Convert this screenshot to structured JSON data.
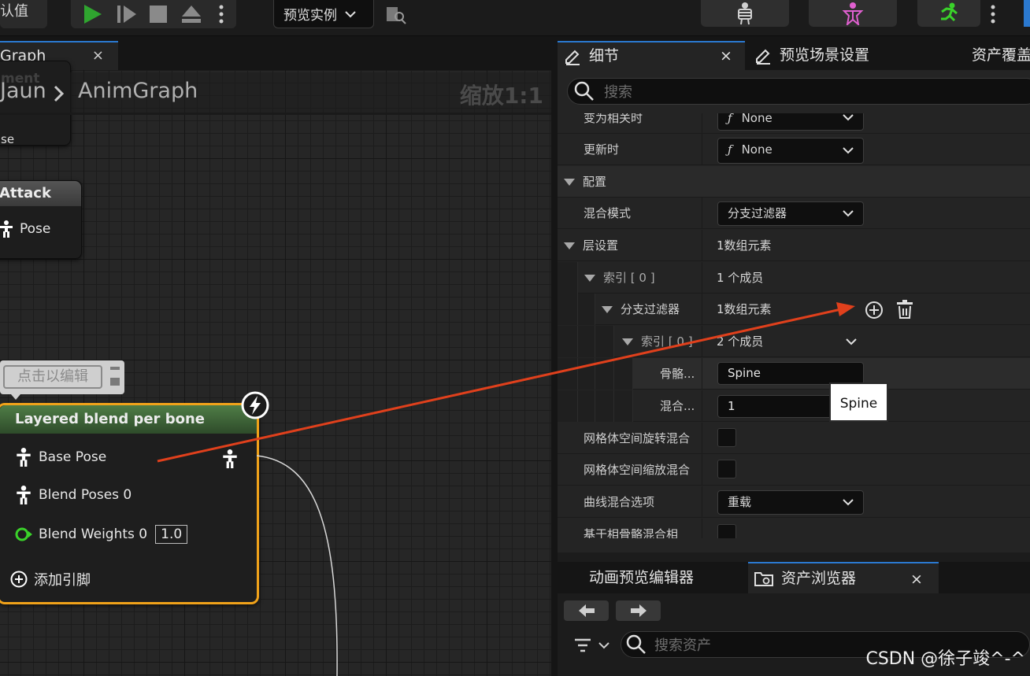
{
  "toolbar": {
    "class_defaults_label": "认值",
    "preview_instance_label": "预览实例"
  },
  "graph": {
    "tab_label": "Graph",
    "tab_close": "×",
    "breadcrumb_parent": "Jaun",
    "breadcrumb_current": "AnimGraph",
    "zoom_label": "缩放1:1",
    "comment_edit_label": "点击以编辑",
    "partial_node": {
      "line1": "ment",
      "line2": "se"
    },
    "attack_node": {
      "title": "Attack",
      "pin_label": "Pose"
    },
    "layered_node": {
      "title": "Layered blend per bone",
      "pins": {
        "base_pose": "Base Pose",
        "blend_poses": "Blend Poses 0",
        "blend_weights": "Blend Weights 0",
        "blend_weight_value": "1.0",
        "add_pin": "添加引脚"
      }
    }
  },
  "details": {
    "tab_details": "细节",
    "tab_close": "×",
    "tab_preview_scene": "预览场景设置",
    "tab_asset_override": "资产覆盖",
    "search_placeholder": "搜索",
    "rows": {
      "become_relevant_label": "变为相关时",
      "become_relevant_value": "None",
      "on_update_label": "更新时",
      "on_update_value": "None",
      "config_label": "配置",
      "blend_mode_label": "混合模式",
      "blend_mode_value": "分支过滤器",
      "layer_setup_label": "层设置",
      "layer_setup_value": "1数组元素",
      "index0_label": "索引 [ 0 ]",
      "index0_value": "1 个成员",
      "branch_filters_label": "分支过滤器",
      "branch_filters_value": "1数组元素",
      "index0b_label": "索引 [ 0 ]",
      "index0b_value": "2 个成员",
      "bone_label": "骨骼...",
      "bone_value": "Spine",
      "blend_depth_label": "混合...",
      "blend_depth_value": "1",
      "mesh_rot_label": "网格体空间旋转混合",
      "mesh_scale_label": "网格体空间缩放混合",
      "curve_blend_label": "曲线混合选项",
      "curve_blend_value": "重载",
      "ref_pose_label": "基于相骨骼混合相"
    },
    "tooltip": "Spine"
  },
  "bottom": {
    "tab_anim_preview": "动画预览编辑器",
    "tab_asset_browser": "资产浏览器",
    "tab_close": "×",
    "search_placeholder": "搜索资产"
  },
  "watermark": "CSDN @徐子竣^-^",
  "colors": {
    "accent_blue": "#2b79d0",
    "node_selected_border": "#f0a21a",
    "node_title_green": "#3f6a3a",
    "annotation_arrow": "#e0401c",
    "play_green": "#2fa52f",
    "float_pin_green": "#3ad22a"
  }
}
